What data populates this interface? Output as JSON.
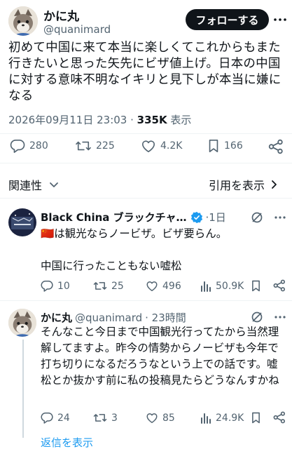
{
  "main_post": {
    "author_name": "かに丸",
    "author_handle": "@quanimard",
    "follow_label": "フォローする",
    "text": "初めて中国に来て本当に楽しくてこれからもまた行きたいと思った矢先にビザ値上げ。日本の中国に対する意味不明なイキリと見下しが本当に嫌になる",
    "timestamp": "2026年09月11日 23:03",
    "separator": " · ",
    "views": "335K",
    "views_label": " 表示",
    "actions": {
      "replies": "280",
      "reposts": "225",
      "likes": "4.2K",
      "bookmarks": "166"
    }
  },
  "sort_bar": {
    "relevance_label": "関連性",
    "quotes_label": "引用を表示"
  },
  "replies": [
    {
      "author_name": "Black China ブラックチャ…",
      "verified": true,
      "time": "·1日",
      "text_line1": "🇨🇳は観光ならノービザ。ビザ要らん。",
      "text_line2": "中国に行ったこともない嘘松",
      "actions": {
        "replies": "10",
        "reposts": "25",
        "likes": "496",
        "views": "50.9K"
      }
    },
    {
      "author_name": "かに丸",
      "author_handle": "@quanimard",
      "time": "· 23時間",
      "text": "そんなこと今日まで中国観光行ってたから当然理解してますよ。昨今の情勢からノービザも今年で打ち切りになるだろうなという上での話です。嘘松とか抜かす前に私の投稿見たらどうなんすかね",
      "actions": {
        "replies": "24",
        "reposts": "3",
        "likes": "85",
        "views": "24.9K"
      }
    }
  ],
  "show_replies_label": "返信を表示",
  "colors": {
    "text": "#0f1419",
    "muted": "#536471",
    "link": "#1d9bf0",
    "verified": "#1d9bf0",
    "divider": "#eff3f4"
  }
}
